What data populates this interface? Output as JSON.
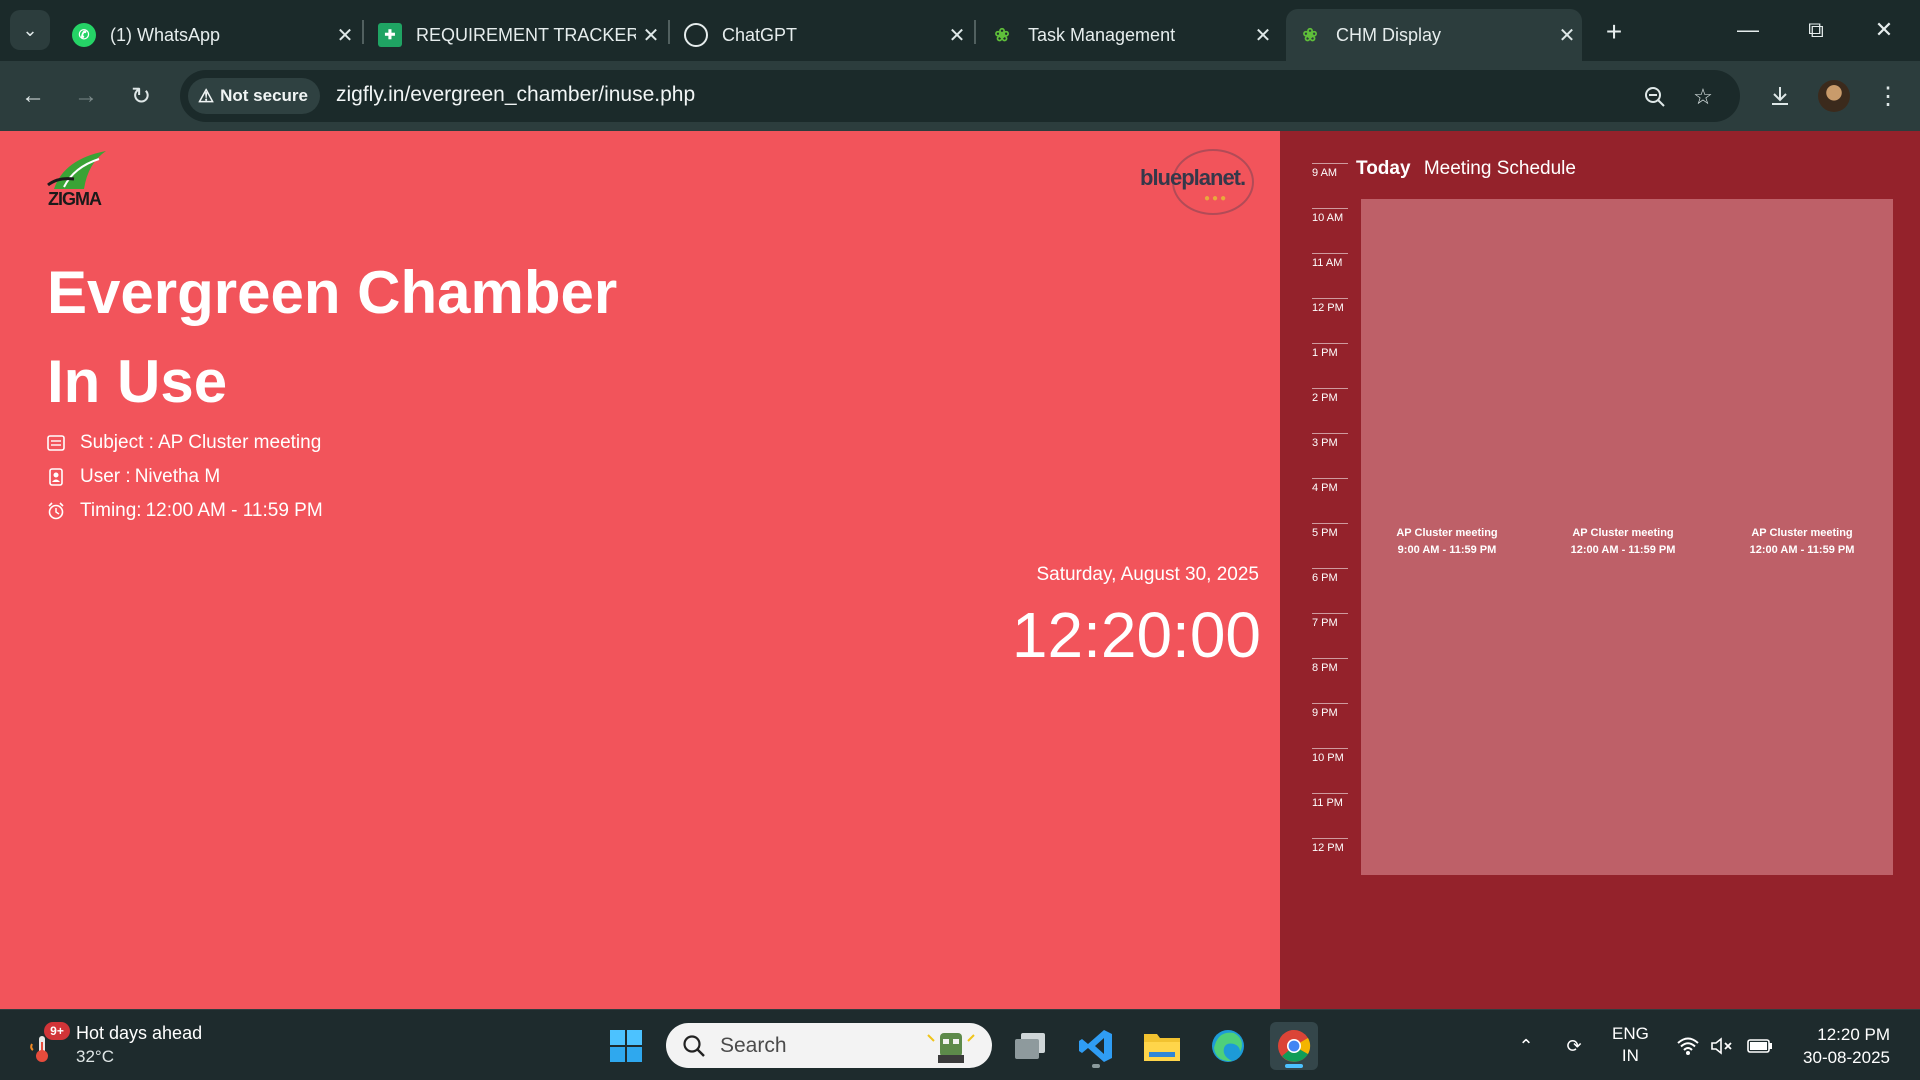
{
  "browser": {
    "tabs": [
      {
        "title": "(1) WhatsApp",
        "icon": "whatsapp-icon"
      },
      {
        "title": "REQUIREMENT TRACKER",
        "icon": "sheets-icon"
      },
      {
        "title": "ChatGPT",
        "icon": "chatgpt-icon"
      },
      {
        "title": "Task Management",
        "icon": "leaf-icon"
      },
      {
        "title": "CHM Display",
        "icon": "leaf-icon",
        "active": true
      }
    ],
    "security_label": "Not secure",
    "url": "zigfly.in/evergreen_chamber/inuse.php"
  },
  "page": {
    "colors": {
      "status_bg": "#f2545b",
      "schedule_bg": "#94222b",
      "event_block": "#be6068"
    },
    "logos": {
      "left": "ZIGMA",
      "right": "blueplanet."
    },
    "room_name": "Evergreen Chamber",
    "room_status": "In Use",
    "meeting": {
      "subject_label": "Subject :",
      "subject": "AP Cluster meeting",
      "user_label": "User :",
      "user": "Nivetha M",
      "timing_label": "Timing:",
      "timing": "12:00 AM - 11:59 PM"
    },
    "date": "Saturday, August 30, 2025",
    "time": "12:20:00"
  },
  "schedule": {
    "today_label": "Today",
    "title": "Meeting Schedule",
    "hours": [
      "9 AM",
      "10 AM",
      "11 AM",
      "12 PM",
      "1 PM",
      "2 PM",
      "3 PM",
      "4 PM",
      "5 PM",
      "6 PM",
      "7 PM",
      "8 PM",
      "9 PM",
      "10 PM",
      "11 PM",
      "12 PM"
    ],
    "events": [
      {
        "title": "AP Cluster meeting",
        "time": "9:00 AM - 11:59 PM"
      },
      {
        "title": "AP Cluster meeting",
        "time": "12:00 AM - 11:59 PM"
      },
      {
        "title": "AP Cluster meeting",
        "time": "12:00 AM - 11:59 PM"
      }
    ]
  },
  "taskbar": {
    "weather_badge": "9+",
    "weather_title": "Hot days ahead",
    "weather_temp": "32°C",
    "search_label": "Search",
    "lang_line1": "ENG",
    "lang_line2": "IN",
    "time": "12:20 PM",
    "date": "30-08-2025"
  }
}
